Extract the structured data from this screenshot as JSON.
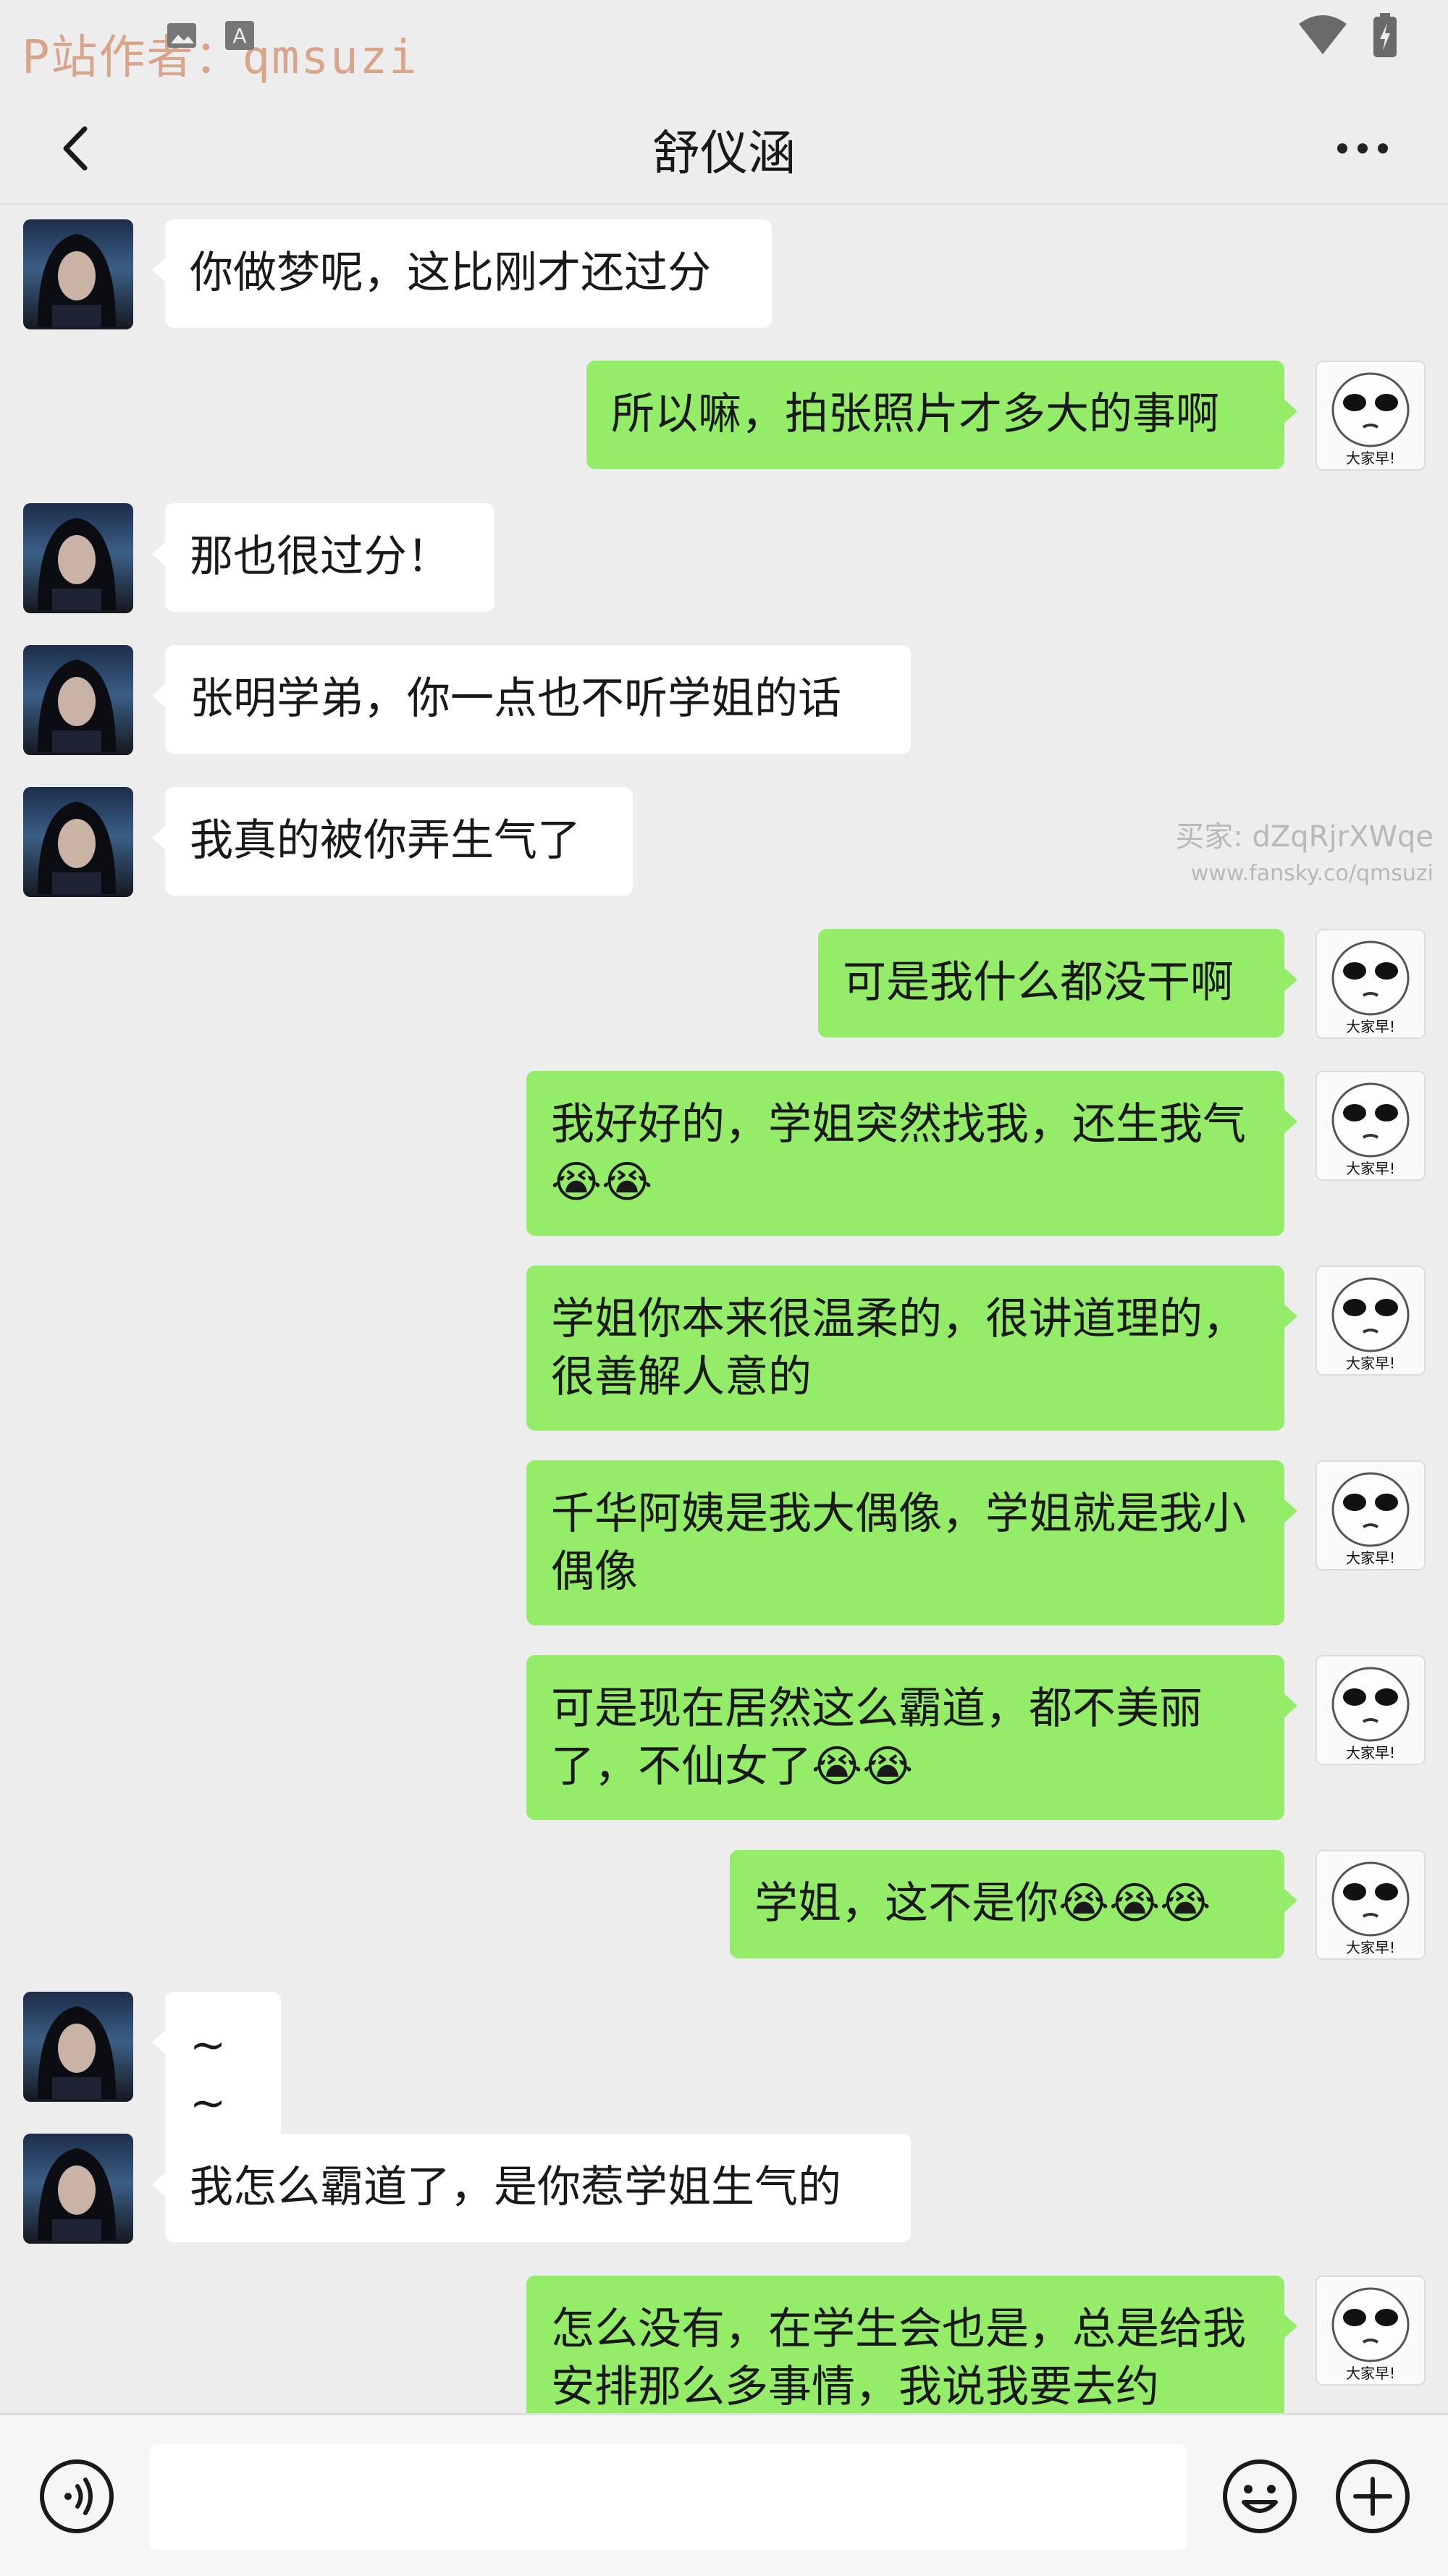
{
  "status_bar": {
    "watermark": "P站作者：qmsuzi",
    "icons": [
      "image-icon",
      "font-icon",
      "wifi-icon",
      "battery-charging-icon"
    ]
  },
  "header": {
    "title": "舒仪涵",
    "back_icon": "chevron-left-icon",
    "more_icon": "more-horizontal-icon"
  },
  "seller_watermark": {
    "line1": "买家: dZqRjrXWqe",
    "line2": "www.fansky.co/qmsuzi"
  },
  "emoji_legend": {
    "😭": "loudly-crying-face"
  },
  "avatar_caption": "大家早!",
  "messages": [
    {
      "side": "in",
      "text": "你做梦呢，这比刚才还过分"
    },
    {
      "side": "out",
      "text": "所以嘛，拍张照片才多大的事啊"
    },
    {
      "side": "in",
      "text": "那也很过分！"
    },
    {
      "side": "in",
      "text": "张明学弟，你一点也不听学姐的话"
    },
    {
      "side": "in",
      "text": "我真的被你弄生气了"
    },
    {
      "side": "out",
      "text": "可是我什么都没干啊"
    },
    {
      "side": "out",
      "text": "我好好的，学姐突然找我，还生我气😭😭"
    },
    {
      "side": "out",
      "text": "学姐你本来很温柔的，很讲道理的，很善解人意的"
    },
    {
      "side": "out",
      "text": "千华阿姨是我大偶像，学姐就是我小偶像"
    },
    {
      "side": "out",
      "text": "可是现在居然这么霸道，都不美丽了，不仙女了😭😭"
    },
    {
      "side": "out",
      "text": "学姐，这不是你😭😭😭"
    },
    {
      "side": "in",
      "text": "~~"
    },
    {
      "side": "in",
      "text": "我怎么霸道了，是你惹学姐生气的"
    },
    {
      "side": "out",
      "text": "怎么没有，在学生会也是，总是给我安排那么多事情，我说我要去约"
    }
  ],
  "input_bar": {
    "placeholder": "",
    "voice_icon": "voice-icon",
    "emoji_icon": "emoji-icon",
    "plus_icon": "plus-circle-icon"
  }
}
